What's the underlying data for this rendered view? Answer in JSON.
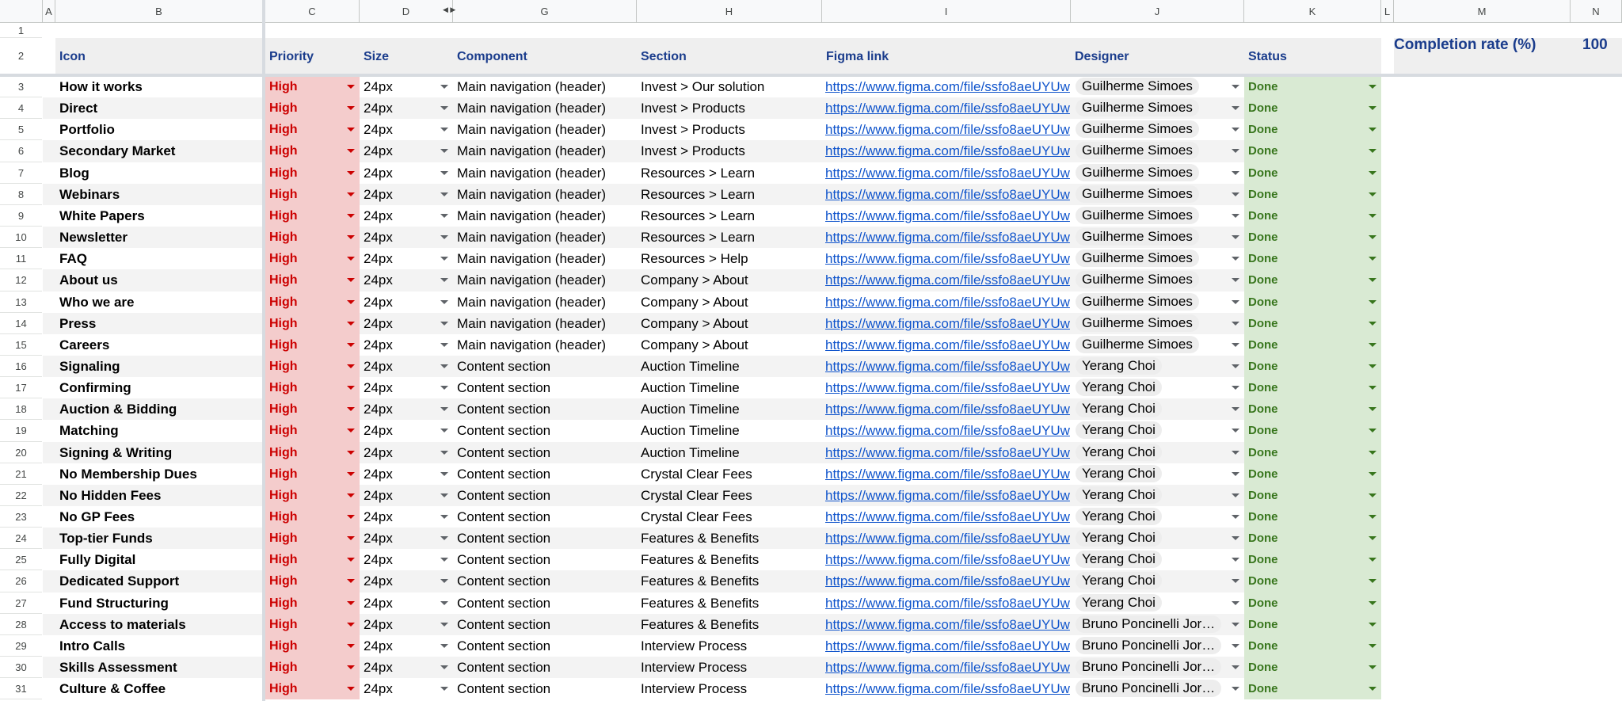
{
  "columns": [
    "A",
    "B",
    "C",
    "D",
    "G",
    "H",
    "I",
    "J",
    "K",
    "L",
    "M",
    "N"
  ],
  "headers": {
    "icon": "Icon",
    "priority": "Priority",
    "size": "Size",
    "component": "Component",
    "section": "Section",
    "figma_link": "Figma link",
    "designer": "Designer",
    "status": "Status"
  },
  "completion": {
    "label": "Completion rate (%)",
    "value": "100"
  },
  "colors": {
    "priority_bg": "#f4cccc",
    "priority_text": "#cc0000",
    "status_bg": "#d9ead3",
    "status_text": "#38761d",
    "link": "#1155cc",
    "header_text": "#1a3c8c"
  },
  "rows": [
    {
      "num": "3",
      "icon": "How it works",
      "priority": "High",
      "size": "24px",
      "component": "Main navigation (header)",
      "section": "Invest > Our solution",
      "link": "https://www.figma.com/file/ssfo8aeUYUw",
      "designer": "Guilherme Simoes",
      "status": "Done"
    },
    {
      "num": "4",
      "icon": "Direct",
      "priority": "High",
      "size": "24px",
      "component": "Main navigation (header)",
      "section": "Invest > Products",
      "link": "https://www.figma.com/file/ssfo8aeUYUw",
      "designer": "Guilherme Simoes",
      "status": "Done"
    },
    {
      "num": "5",
      "icon": "Portfolio",
      "priority": "High",
      "size": "24px",
      "component": "Main navigation (header)",
      "section": "Invest > Products",
      "link": "https://www.figma.com/file/ssfo8aeUYUw",
      "designer": "Guilherme Simoes",
      "status": "Done"
    },
    {
      "num": "6",
      "icon": "Secondary Market",
      "priority": "High",
      "size": "24px",
      "component": "Main navigation (header)",
      "section": "Invest > Products",
      "link": "https://www.figma.com/file/ssfo8aeUYUw",
      "designer": "Guilherme Simoes",
      "status": "Done"
    },
    {
      "num": "7",
      "icon": "Blog",
      "priority": "High",
      "size": "24px",
      "component": "Main navigation (header)",
      "section": "Resources > Learn",
      "link": "https://www.figma.com/file/ssfo8aeUYUw",
      "designer": "Guilherme Simoes",
      "status": "Done"
    },
    {
      "num": "8",
      "icon": "Webinars",
      "priority": "High",
      "size": "24px",
      "component": "Main navigation (header)",
      "section": "Resources > Learn",
      "link": "https://www.figma.com/file/ssfo8aeUYUw",
      "designer": "Guilherme Simoes",
      "status": "Done"
    },
    {
      "num": "9",
      "icon": "White Papers",
      "priority": "High",
      "size": "24px",
      "component": "Main navigation (header)",
      "section": "Resources > Learn",
      "link": "https://www.figma.com/file/ssfo8aeUYUw",
      "designer": "Guilherme Simoes",
      "status": "Done"
    },
    {
      "num": "10",
      "icon": "Newsletter",
      "priority": "High",
      "size": "24px",
      "component": "Main navigation (header)",
      "section": "Resources > Learn",
      "link": "https://www.figma.com/file/ssfo8aeUYUw",
      "designer": "Guilherme Simoes",
      "status": "Done"
    },
    {
      "num": "11",
      "icon": "FAQ",
      "priority": "High",
      "size": "24px",
      "component": "Main navigation (header)",
      "section": "Resources > Help",
      "link": "https://www.figma.com/file/ssfo8aeUYUw",
      "designer": "Guilherme Simoes",
      "status": "Done"
    },
    {
      "num": "12",
      "icon": "About us",
      "priority": "High",
      "size": "24px",
      "component": "Main navigation (header)",
      "section": "Company > About",
      "link": "https://www.figma.com/file/ssfo8aeUYUw",
      "designer": "Guilherme Simoes",
      "status": "Done"
    },
    {
      "num": "13",
      "icon": "Who we are",
      "priority": "High",
      "size": "24px",
      "component": "Main navigation (header)",
      "section": "Company > About",
      "link": "https://www.figma.com/file/ssfo8aeUYUw",
      "designer": "Guilherme Simoes",
      "status": "Done"
    },
    {
      "num": "14",
      "icon": "Press",
      "priority": "High",
      "size": "24px",
      "component": "Main navigation (header)",
      "section": "Company > About",
      "link": "https://www.figma.com/file/ssfo8aeUYUw",
      "designer": "Guilherme Simoes",
      "status": "Done"
    },
    {
      "num": "15",
      "icon": "Careers",
      "priority": "High",
      "size": "24px",
      "component": "Main navigation (header)",
      "section": "Company > About",
      "link": "https://www.figma.com/file/ssfo8aeUYUw",
      "designer": "Guilherme Simoes",
      "status": "Done"
    },
    {
      "num": "16",
      "icon": "Signaling",
      "priority": "High",
      "size": "24px",
      "component": "Content section",
      "section": "Auction Timeline",
      "link": "https://www.figma.com/file/ssfo8aeUYUw",
      "designer": "Yerang Choi",
      "status": "Done"
    },
    {
      "num": "17",
      "icon": "Confirming",
      "priority": "High",
      "size": "24px",
      "component": "Content section",
      "section": "Auction Timeline",
      "link": "https://www.figma.com/file/ssfo8aeUYUw",
      "designer": "Yerang Choi",
      "status": "Done"
    },
    {
      "num": "18",
      "icon": "Auction & Bidding",
      "priority": "High",
      "size": "24px",
      "component": "Content section",
      "section": "Auction Timeline",
      "link": "https://www.figma.com/file/ssfo8aeUYUw",
      "designer": "Yerang Choi",
      "status": "Done"
    },
    {
      "num": "19",
      "icon": "Matching",
      "priority": "High",
      "size": "24px",
      "component": "Content section",
      "section": "Auction Timeline",
      "link": "https://www.figma.com/file/ssfo8aeUYUw",
      "designer": "Yerang Choi",
      "status": "Done"
    },
    {
      "num": "20",
      "icon": "Signing & Writing",
      "priority": "High",
      "size": "24px",
      "component": "Content section",
      "section": "Auction Timeline",
      "link": "https://www.figma.com/file/ssfo8aeUYUw",
      "designer": "Yerang Choi",
      "status": "Done"
    },
    {
      "num": "21",
      "icon": "No Membership Dues",
      "priority": "High",
      "size": "24px",
      "component": "Content section",
      "section": "Crystal Clear Fees",
      "link": "https://www.figma.com/file/ssfo8aeUYUw",
      "designer": "Yerang Choi",
      "status": "Done"
    },
    {
      "num": "22",
      "icon": "No Hidden Fees",
      "priority": "High",
      "size": "24px",
      "component": "Content section",
      "section": "Crystal Clear Fees",
      "link": "https://www.figma.com/file/ssfo8aeUYUw",
      "designer": "Yerang Choi",
      "status": "Done"
    },
    {
      "num": "23",
      "icon": "No GP Fees",
      "priority": "High",
      "size": "24px",
      "component": "Content section",
      "section": "Crystal Clear Fees",
      "link": "https://www.figma.com/file/ssfo8aeUYUw",
      "designer": "Yerang Choi",
      "status": "Done"
    },
    {
      "num": "24",
      "icon": "Top-tier Funds",
      "priority": "High",
      "size": "24px",
      "component": "Content section",
      "section": "Features & Benefits",
      "link": "https://www.figma.com/file/ssfo8aeUYUw",
      "designer": "Yerang Choi",
      "status": "Done"
    },
    {
      "num": "25",
      "icon": "Fully Digital",
      "priority": "High",
      "size": "24px",
      "component": "Content section",
      "section": "Features & Benefits",
      "link": "https://www.figma.com/file/ssfo8aeUYUw",
      "designer": "Yerang Choi",
      "status": "Done"
    },
    {
      "num": "26",
      "icon": "Dedicated Support",
      "priority": "High",
      "size": "24px",
      "component": "Content section",
      "section": "Features & Benefits",
      "link": "https://www.figma.com/file/ssfo8aeUYUw",
      "designer": "Yerang Choi",
      "status": "Done"
    },
    {
      "num": "27",
      "icon": "Fund Structuring",
      "priority": "High",
      "size": "24px",
      "component": "Content section",
      "section": "Features & Benefits",
      "link": "https://www.figma.com/file/ssfo8aeUYUw",
      "designer": "Yerang Choi",
      "status": "Done"
    },
    {
      "num": "28",
      "icon": "Access to materials",
      "priority": "High",
      "size": "24px",
      "component": "Content section",
      "section": "Features & Benefits",
      "link": "https://www.figma.com/file/ssfo8aeUYUw",
      "designer": "Bruno Poncinelli Jor…",
      "status": "Done"
    },
    {
      "num": "29",
      "icon": "Intro Calls",
      "priority": "High",
      "size": "24px",
      "component": "Content section",
      "section": "Interview Process",
      "link": "https://www.figma.com/file/ssfo8aeUYUw",
      "designer": "Bruno Poncinelli Jor…",
      "status": "Done"
    },
    {
      "num": "30",
      "icon": "Skills Assessment",
      "priority": "High",
      "size": "24px",
      "component": "Content section",
      "section": "Interview Process",
      "link": "https://www.figma.com/file/ssfo8aeUYUw",
      "designer": "Bruno Poncinelli Jor…",
      "status": "Done"
    },
    {
      "num": "31",
      "icon": "Culture & Coffee",
      "priority": "High",
      "size": "24px",
      "component": "Content section",
      "section": "Interview Process",
      "link": "https://www.figma.com/file/ssfo8aeUYUw",
      "designer": "Bruno Poncinelli Jor…",
      "status": "Done"
    }
  ]
}
